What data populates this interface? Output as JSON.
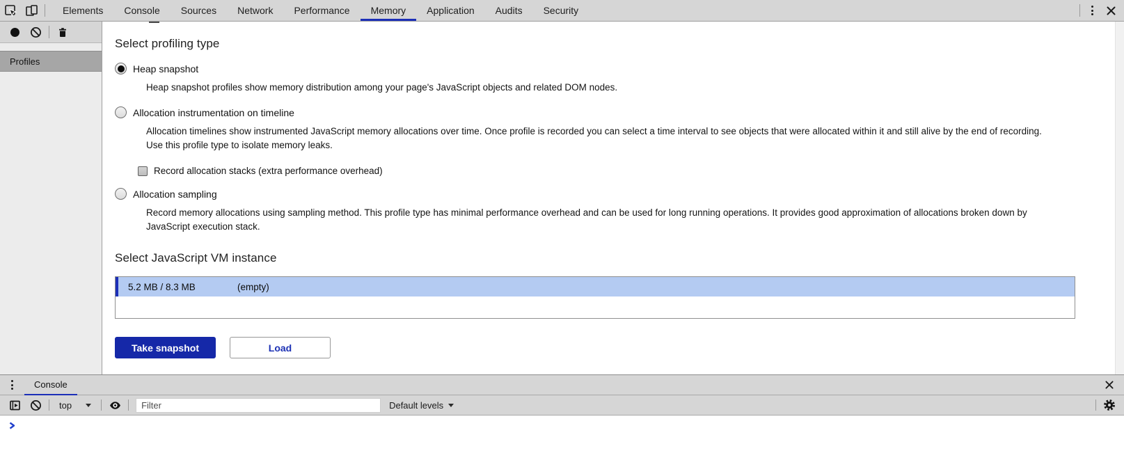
{
  "colors": {
    "accent": "#1c2fb8",
    "primary_button": "#1528a8",
    "vm_row_bg": "#b4cbf2",
    "toolbar_bg": "#d6d6d6"
  },
  "icons": {
    "inspect": "cursor-in-box",
    "device_toolbar": "overlapping-devices",
    "record": "filled-circle",
    "clear": "ban-circle",
    "trash": "trash-can",
    "kebab": "vertical-dots",
    "close": "x",
    "console_sidebar": "panel-with-play",
    "eye": "eye",
    "gear": "gear",
    "prompt": "blue-chevron",
    "dropdown": "caret-down"
  },
  "tabs": [
    {
      "label": "Elements"
    },
    {
      "label": "Console"
    },
    {
      "label": "Sources"
    },
    {
      "label": "Network"
    },
    {
      "label": "Performance"
    },
    {
      "label": "Memory"
    },
    {
      "label": "Application"
    },
    {
      "label": "Audits"
    },
    {
      "label": "Security"
    }
  ],
  "sidebar": {
    "items": [
      {
        "label": "Profiles"
      }
    ]
  },
  "main": {
    "heading1": "Select profiling type",
    "options": [
      {
        "label": "Heap snapshot",
        "desc": "Heap snapshot profiles show memory distribution among your page's JavaScript objects and related DOM nodes."
      },
      {
        "label": "Allocation instrumentation on timeline",
        "desc": "Allocation timelines show instrumented JavaScript memory allocations over time. Once profile is recorded you can select a time interval to see objects that were allocated within it and still alive by the end of recording. Use this profile type to isolate memory leaks.",
        "checkbox_label": "Record allocation stacks (extra performance overhead)"
      },
      {
        "label": "Allocation sampling",
        "desc": "Record memory allocations using sampling method. This profile type has minimal performance overhead and can be used for long running operations. It provides good approximation of allocations broken down by JavaScript execution stack."
      }
    ],
    "heading2": "Select JavaScript VM instance",
    "vm_instance": {
      "size": "5.2 MB / 8.3 MB",
      "title": "(empty)"
    },
    "buttons": {
      "take_snapshot": "Take snapshot",
      "load": "Load"
    }
  },
  "drawer": {
    "tab": "Console",
    "context": "top",
    "filter_placeholder": "Filter",
    "levels": "Default levels"
  }
}
